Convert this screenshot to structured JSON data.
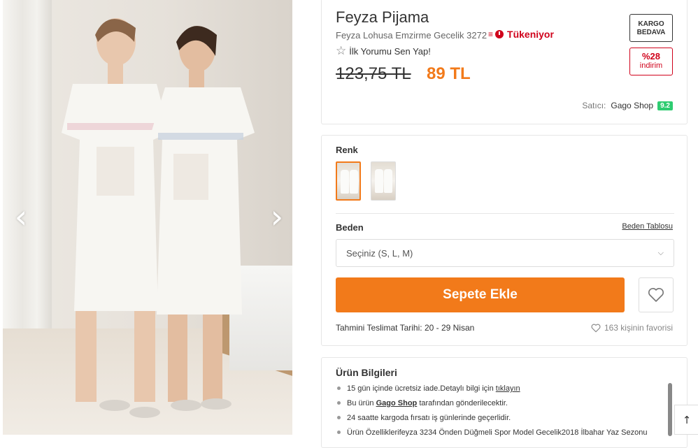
{
  "gallery": {
    "prev_icon": "‹",
    "next_icon": "›"
  },
  "product": {
    "brand": "Feyza Pijama",
    "name": "Feyza Lohusa Emzirme Gecelik 3272",
    "status_icon": "≡",
    "status": "Tükeniyor",
    "review_star": "☆",
    "review_cta": "İlk Yorumu Sen Yap!",
    "old_price": "123,75 TL",
    "price": "89 TL",
    "price_color": "#f27a1a",
    "badge_kargo": "KARGO BEDAVA",
    "badge_discount_pct": "%28",
    "badge_discount_label": "indirim",
    "seller_label": "Satıcı:",
    "seller_name": "Gago Shop",
    "seller_score": "9.2"
  },
  "options": {
    "color_label": "Renk",
    "size_label": "Beden",
    "size_chart_link": "Beden Tablosu",
    "size_placeholder": "Seçiniz (S, L, M)",
    "chevron": "⌵",
    "add_to_cart": "Sepete Ekle",
    "delivery": "Tahmini Teslimat Tarihi: 20 - 29 Nisan",
    "favorites": "163 kişinin favorisi"
  },
  "info": {
    "title": "Ürün Bilgileri",
    "items": [
      {
        "text": "15 gün içinde ücretsiz iade.Detaylı bilgi için ",
        "link": "tıklayın"
      },
      {
        "pre": "Bu ürün ",
        "bold": "Gago Shop",
        "post": " tarafından gönderilecektir."
      },
      {
        "text": "24 saatte kargoda fırsatı iş günlerinde geçerlidir."
      },
      {
        "text": "Ürün Özelliklerifeyza 3234 Önden Düğmeli Spor Model Gecelik2018 İlbahar Yaz Sezonu"
      }
    ]
  },
  "scroll_top_icon": "↑"
}
